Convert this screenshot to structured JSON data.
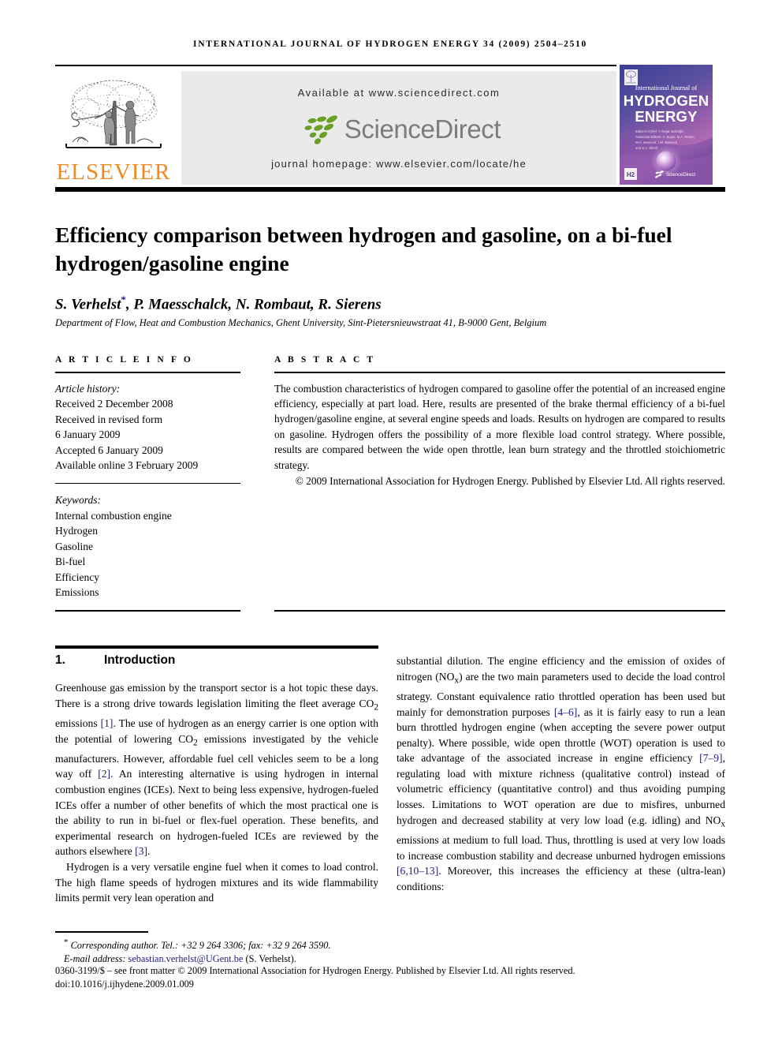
{
  "running_head": "INTERNATIONAL JOURNAL OF HYDROGEN ENERGY 34 (2009) 2504–2510",
  "masthead": {
    "publisher_name": "ELSEVIER",
    "publisher_logo_icon": "elsevier-tree-icon",
    "available_at": "Available at www.sciencedirect.com",
    "sciencedirect_wordmark": "ScienceDirect",
    "sciencedirect_leaf_icon": "sciencedirect-leaf-icon",
    "journal_homepage": "journal homepage: www.elsevier.com/locate/he",
    "cover": {
      "line1": "International Journal of",
      "line2": "HYDROGEN",
      "line3": "ENERGY",
      "editors_line1": "Editor-in-Chief:  T. Nejat Veziroğlu",
      "editors_line2": "Associate Editors:  A. Bejan, M.A. Rosen,",
      "editors_line3": "W.A. Manzoor, J.M. Norbeck",
      "editors_line4": "and S.A. Sherif",
      "footer_brand": "ScienceDirect",
      "badge": "H2"
    }
  },
  "article": {
    "title": "Efficiency comparison between hydrogen and gasoline, on a bi-fuel hydrogen/gasoline engine",
    "authors": "S. Verhelst",
    "authors_rest": ", P. Maesschalck, N. Rombaut, R. Sierens",
    "corresponding_marker": "*",
    "affiliation": "Department of Flow, Heat and Combustion Mechanics, Ghent University, Sint-Pietersnieuwstraat 41, B-9000 Gent, Belgium"
  },
  "article_info": {
    "heading": "A R T I C L E   I N F O",
    "history_label": "Article history:",
    "history": [
      "Received 2 December 2008",
      "Received in revised form",
      "6 January 2009",
      "Accepted 6 January 2009",
      "Available online 3 February 2009"
    ],
    "keywords_label": "Keywords:",
    "keywords": [
      "Internal combustion engine",
      "Hydrogen",
      "Gasoline",
      "Bi-fuel",
      "Efficiency",
      "Emissions"
    ]
  },
  "abstract": {
    "heading": "A B S T R A C T",
    "text": "The combustion characteristics of hydrogen compared to gasoline offer the potential of an increased engine efficiency, especially at part load. Here, results are presented of the brake thermal efficiency of a bi-fuel hydrogen/gasoline engine, at several engine speeds and loads. Results on hydrogen are compared to results on gasoline. Hydrogen offers the possibility of a more flexible load control strategy. Where possible, results are compared between the wide open throttle, lean burn strategy and the throttled stoichiometric strategy.",
    "copyright": "© 2009 International Association for Hydrogen Energy. Published by Elsevier Ltd. All rights reserved."
  },
  "body": {
    "section_number": "1.",
    "section_title": "Introduction",
    "left_paragraph_1_a": "Greenhouse gas emission by the transport sector is a hot topic these days. There is a strong drive towards legislation limiting the fleet average CO",
    "left_paragraph_1_b": " emissions ",
    "left_ref_1": "[1]",
    "left_paragraph_1_c": ". The use of hydrogen as an energy carrier is one option with the potential of lowering CO",
    "left_paragraph_1_d": " emissions investigated by the vehicle manufacturers. However, affordable fuel cell vehicles seem to be a long way off ",
    "left_ref_2": "[2]",
    "left_paragraph_1_e": ". An interesting alternative is using hydrogen in internal combustion engines (ICEs). Next to being less expensive, hydrogen-fueled ICEs offer a number of other benefits of which the most practical one is the ability to run in bi-fuel or flex-fuel operation. These benefits, and experimental research on hydrogen-fueled ICEs are reviewed by the authors elsewhere ",
    "left_ref_3": "[3]",
    "left_paragraph_1_f": ".",
    "left_paragraph_2": "Hydrogen is a very versatile engine fuel when it comes to load control. The high flame speeds of hydrogen mixtures and its wide flammability limits permit very lean operation and",
    "right_paragraph_a": "substantial dilution. The engine efficiency and the emission of oxides of nitrogen (NO",
    "right_sub_x1": "x",
    "right_paragraph_b": ") are the two main parameters used to decide the load control strategy. Constant equivalence ratio throttled operation has been used but mainly for demonstration purposes ",
    "right_ref_1": "[4–6]",
    "right_paragraph_c": ", as it is fairly easy to run a lean burn throttled hydrogen engine (when accepting the severe power output penalty). Where possible, wide open throttle (WOT) operation is used to take advantage of the associated increase in engine efficiency ",
    "right_ref_2": "[7–9]",
    "right_paragraph_d": ", regulating load with mixture richness (qualitative control) instead of volumetric efficiency (quantitative control) and thus avoiding pumping losses. Limitations to WOT operation are due to misfires, unburned hydrogen and decreased stability at very low load (e.g. idling) and NO",
    "right_sub_x2": "x",
    "right_paragraph_e": " emissions at medium to full load. Thus, throttling is used at very low loads to increase combustion stability and decrease unburned hydrogen emissions ",
    "right_ref_3": "[6,10–13]",
    "right_paragraph_f": ". Moreover, this increases the efficiency at these (ultra-lean) conditions:"
  },
  "footnote": {
    "marker": "*",
    "corresponding": "Corresponding author. Tel.: +32 9 264 3306; fax: +32 9 264 3590.",
    "email_label": "E-mail address:",
    "email": "sebastian.verhelst@UGent.be",
    "email_owner": "(S. Verhelst)."
  },
  "front_matter": {
    "line1": "0360-3199/$ – see front matter © 2009 International Association for Hydrogen Energy. Published by Elsevier Ltd. All rights reserved.",
    "doi": "doi:10.1016/j.ijhydene.2009.01.009"
  },
  "colors": {
    "elsevier_orange": "#f18a21",
    "sciencedirect_green": "#6aa023",
    "sciencedirect_gray": "#7c7c7c",
    "reference_blue": "#202080",
    "banner_gray": "#eaeaea"
  }
}
